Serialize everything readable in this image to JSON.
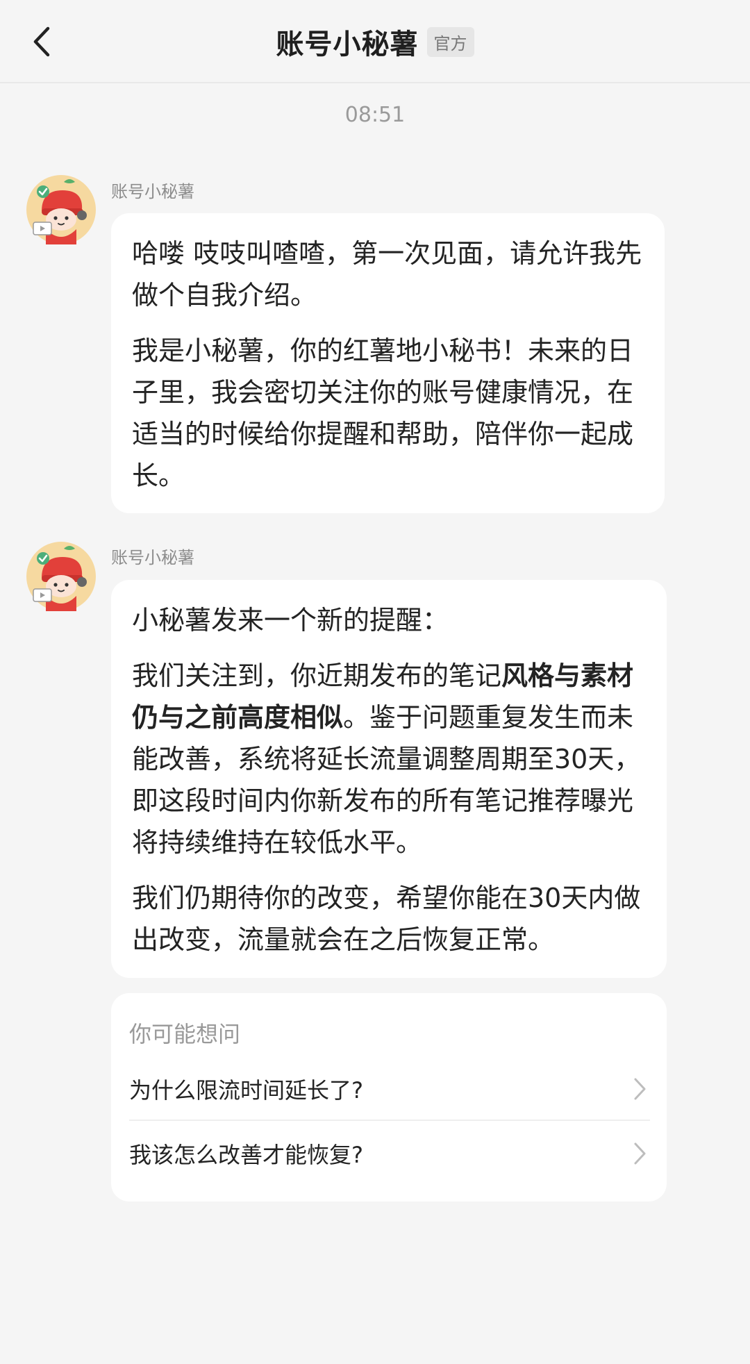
{
  "header": {
    "title": "账号小秘薯",
    "badge": "官方"
  },
  "timestamp": "08:51",
  "messages": [
    {
      "sender": "账号小秘薯",
      "paragraphs": [
        "哈喽 吱吱叫喳喳，第一次见面，请允许我先做个自我介绍。",
        "我是小秘薯，你的红薯地小秘书！未来的日子里，我会密切关注你的账号健康情况，在适当的时候给你提醒和帮助，陪伴你一起成长。"
      ]
    },
    {
      "sender": "账号小秘薯",
      "intro": "小秘薯发来一个新的提醒：",
      "para2_before": "我们关注到，你近期发布的笔记",
      "para2_bold": "风格与素材仍与之前高度相似",
      "para2_after": "。鉴于问题重复发生而未能改善，系统将延长流量调整周期至30天，即这段时间内你新发布的所有笔记推荐曝光将持续维持在较低水平。",
      "para3": "我们仍期待你的改变，希望你能在30天内做出改变，流量就会在之后恢复正常。"
    }
  ],
  "faq": {
    "title": "你可能想问",
    "items": [
      "为什么限流时间延长了?",
      "我该怎么改善才能恢复?"
    ]
  },
  "icons": {
    "back": "chevron-left-icon",
    "faq_arrow": "chevron-right-icon",
    "avatar": "mascot-avatar-icon"
  },
  "colors": {
    "background": "#f5f5f5",
    "bubble": "#ffffff",
    "avatar_bg": "#f6d9a0",
    "mascot_red": "#e2403a",
    "check_green": "#4cae7a"
  }
}
